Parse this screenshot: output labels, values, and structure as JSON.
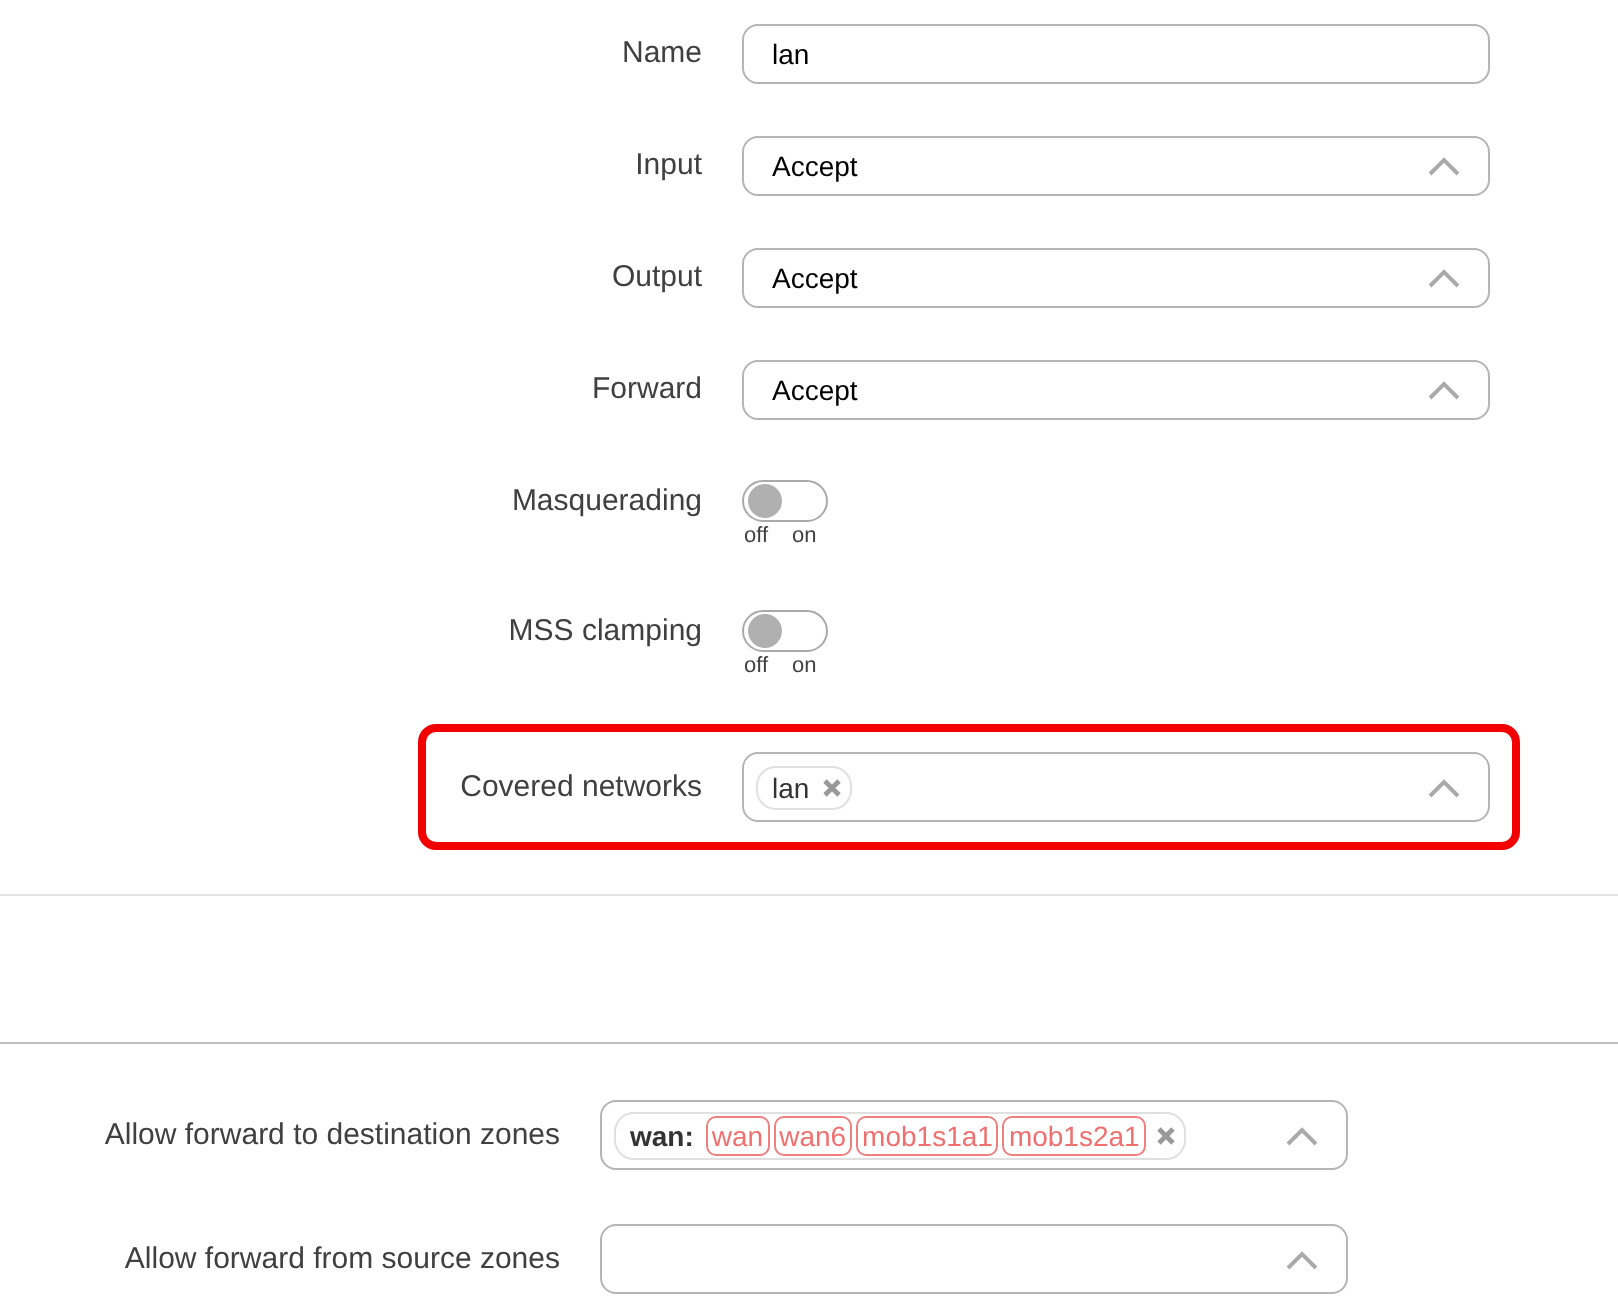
{
  "fields": [
    {
      "kind": "text",
      "label": "Name",
      "value": "lan",
      "highlighted": false
    },
    {
      "kind": "select",
      "label": "Input",
      "value": "Accept",
      "highlighted": false
    },
    {
      "kind": "select",
      "label": "Output",
      "value": "Accept",
      "highlighted": false
    },
    {
      "kind": "select",
      "label": "Forward",
      "value": "Accept",
      "highlighted": false
    },
    {
      "kind": "toggle",
      "label": "Masquerading",
      "on": false,
      "off_label": "off",
      "on_label": "on",
      "highlighted": false
    },
    {
      "kind": "toggle",
      "label": "MSS clamping",
      "on": false,
      "off_label": "off",
      "on_label": "on",
      "highlighted": false
    },
    {
      "kind": "multiselect",
      "label": "Covered networks",
      "tags": [
        "lan"
      ],
      "highlighted": true
    }
  ],
  "zone_forwarding": [
    {
      "label": "Allow forward to destination zones",
      "groups": [
        {
          "name": "wan:",
          "members": [
            "wan",
            "wan6",
            "mob1s1a1",
            "mob1s2a1"
          ]
        }
      ]
    },
    {
      "label": "Allow forward from source zones"
    }
  ]
}
